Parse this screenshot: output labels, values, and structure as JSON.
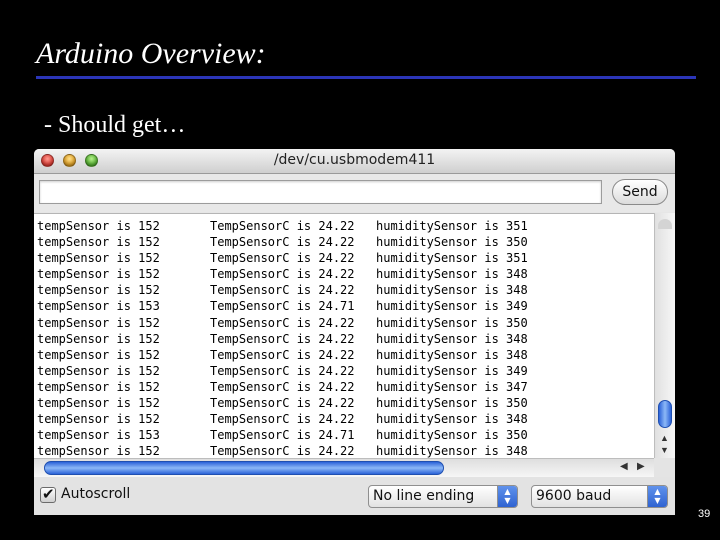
{
  "slide": {
    "title": "Arduino Overview:",
    "bullet": "- Should get…",
    "page_number": "39"
  },
  "window": {
    "title": "/dev/cu.usbmodem411",
    "traffic_lights": {
      "close": "#e0463e",
      "minimize": "#e2a52e",
      "zoom": "#5fb83a"
    }
  },
  "input": {
    "value": "",
    "send_label": "Send"
  },
  "monitor": {
    "rows": [
      {
        "temp": "tempSensor is 152",
        "tempc": "TempSensorC is 24.22",
        "hum": "humiditySensor is 351"
      },
      {
        "temp": "tempSensor is 152",
        "tempc": "TempSensorC is 24.22",
        "hum": "humiditySensor is 350"
      },
      {
        "temp": "tempSensor is 152",
        "tempc": "TempSensorC is 24.22",
        "hum": "humiditySensor is 351"
      },
      {
        "temp": "tempSensor is 152",
        "tempc": "TempSensorC is 24.22",
        "hum": "humiditySensor is 348"
      },
      {
        "temp": "tempSensor is 152",
        "tempc": "TempSensorC is 24.22",
        "hum": "humiditySensor is 348"
      },
      {
        "temp": "tempSensor is 153",
        "tempc": "TempSensorC is 24.71",
        "hum": "humiditySensor is 349"
      },
      {
        "temp": "tempSensor is 152",
        "tempc": "TempSensorC is 24.22",
        "hum": "humiditySensor is 350"
      },
      {
        "temp": "tempSensor is 152",
        "tempc": "TempSensorC is 24.22",
        "hum": "humiditySensor is 348"
      },
      {
        "temp": "tempSensor is 152",
        "tempc": "TempSensorC is 24.22",
        "hum": "humiditySensor is 348"
      },
      {
        "temp": "tempSensor is 152",
        "tempc": "TempSensorC is 24.22",
        "hum": "humiditySensor is 349"
      },
      {
        "temp": "tempSensor is 152",
        "tempc": "TempSensorC is 24.22",
        "hum": "humiditySensor is 347"
      },
      {
        "temp": "tempSensor is 152",
        "tempc": "TempSensorC is 24.22",
        "hum": "humiditySensor is 350"
      },
      {
        "temp": "tempSensor is 152",
        "tempc": "TempSensorC is 24.22",
        "hum": "humiditySensor is 348"
      },
      {
        "temp": "tempSensor is 153",
        "tempc": "TempSensorC is 24.71",
        "hum": "humiditySensor is 350"
      },
      {
        "temp": "tempSensor is 152",
        "tempc": "TempSensorC is 24.22",
        "hum": "humiditySensor is 348"
      }
    ]
  },
  "footer": {
    "autoscroll_label": "Autoscroll",
    "autoscroll_checked": true,
    "line_ending": "No line ending",
    "baud": "9600 baud"
  },
  "colors": {
    "title_rule": "#2b35b8",
    "scroll_accent": "#2b63d8"
  }
}
